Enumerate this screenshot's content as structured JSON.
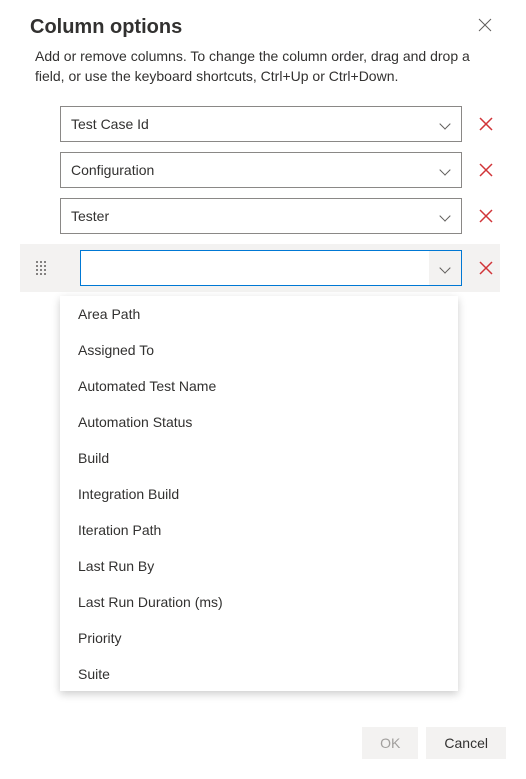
{
  "header": {
    "title": "Column options"
  },
  "description": "Add or remove columns. To change the column order, drag and drop a field, or use the keyboard shortcuts, Ctrl+Up or Ctrl+Down.",
  "columns": [
    {
      "value": "Test Case Id"
    },
    {
      "value": "Configuration"
    },
    {
      "value": "Tester"
    }
  ],
  "active_input_value": "",
  "dropdown_options": [
    "Area Path",
    "Assigned To",
    "Automated Test Name",
    "Automation Status",
    "Build",
    "Integration Build",
    "Iteration Path",
    "Last Run By",
    "Last Run Duration (ms)",
    "Priority",
    "Suite"
  ],
  "footer": {
    "ok_label": "OK",
    "cancel_label": "Cancel"
  }
}
